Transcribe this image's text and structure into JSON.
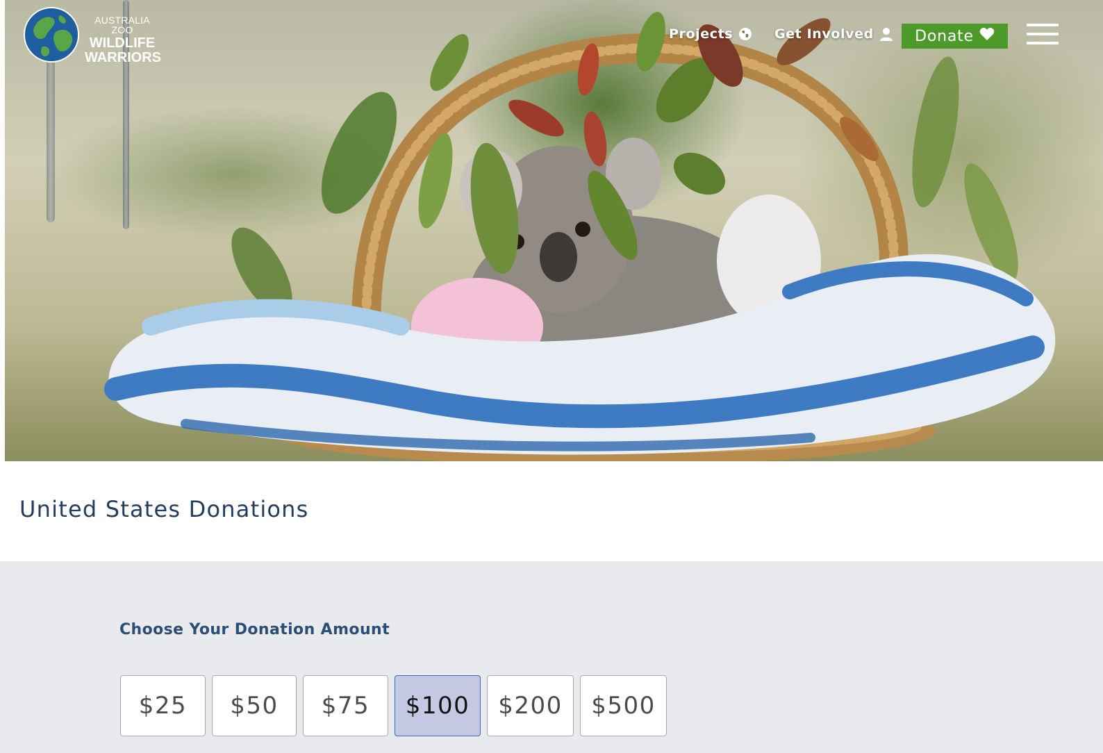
{
  "brand": {
    "line1": "AUSTRALIA ZOO",
    "line2": "WILDLIFE",
    "line3": "WARRIORS"
  },
  "nav": {
    "projects_label": "Projects",
    "get_involved_label": "Get Involved",
    "donate_label": "Donate"
  },
  "page": {
    "title": "United States Donations"
  },
  "donation": {
    "section_label": "Choose Your Donation Amount",
    "amounts": [
      "$25",
      "$50",
      "$75",
      "$100",
      "$200",
      "$500"
    ],
    "selected": "$100"
  },
  "colors": {
    "title": "#243d5c",
    "section_label": "#2b4e74",
    "donate_button": "#4c9a2a",
    "selected_fill": "#c4c8e2",
    "selected_border": "#3b67b5",
    "section_background": "#e9eaee"
  }
}
